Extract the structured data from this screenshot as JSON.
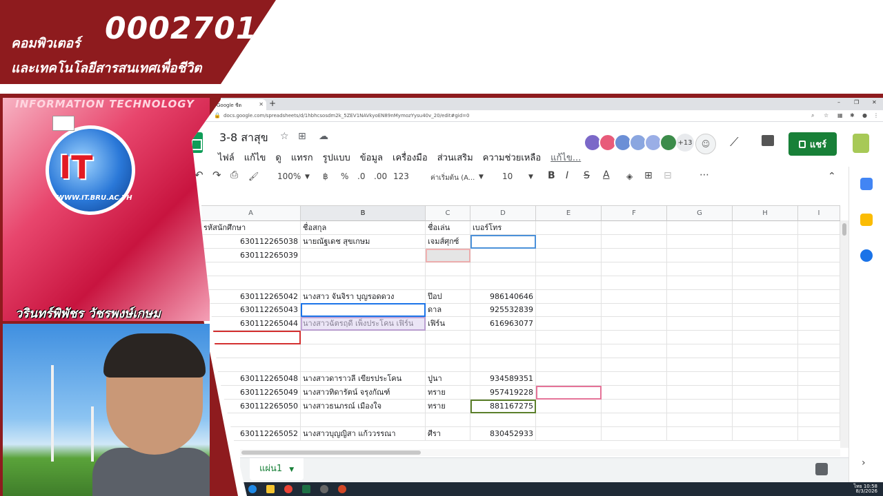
{
  "overlay": {
    "course_code": "0002701",
    "course_line1": "คอมพิวเตอร์",
    "course_line2": "และเทคโนโลยีสารสนเทศเพื่อชีวิต",
    "it_header": "INFORMATION TECHNOLOGY",
    "it_logo": "IT",
    "it_site": "WWW.IT.BRU.AC.TH",
    "presenter": "วรินทร์พิพัชร วัชรพงษ์เกษม"
  },
  "browser": {
    "tab_title": "Google ชีต",
    "new_tab": "+",
    "url": "docs.google.com/spreadsheets/d/1hbhcsosdm2k_5ZEV1NAVkyoEN89nMymozYysu40v_20/edit#gid=0",
    "window_controls": [
      "–",
      "❐",
      "✕"
    ]
  },
  "doc": {
    "title": "3-8 สาสุข",
    "menu": [
      "ไฟล์",
      "แก้ไข",
      "ดู",
      "แทรก",
      "รูปแบบ",
      "ข้อมูล",
      "เครื่องมือ",
      "ส่วนเสริม",
      "ความช่วยเหลือ",
      "แก้ไข..."
    ],
    "collaborators_more": "+13",
    "share_label": "แชร์"
  },
  "toolbar": {
    "undo": "↶",
    "redo": "↷",
    "print": "⎙",
    "zoom": "100%",
    "currency": "฿",
    "percent": "%",
    "dec_less": ".0",
    "dec_more": ".00",
    "format_more": "123",
    "font": "ค่าเริ่มต้น (A...",
    "font_size": "10",
    "bold": "B",
    "italic": "I",
    "strike": "S",
    "text_color": "A",
    "more": "⋯",
    "collapse": "⌃"
  },
  "grid": {
    "columns": [
      "A",
      "B",
      "C",
      "D",
      "E",
      "F",
      "G",
      "H",
      "I"
    ],
    "selected_column": "B",
    "rows": [
      [
        "รหัสนักศึกษา",
        "ชื่อสกุล",
        "ชื่อเล่น",
        "เบอร์โทร"
      ],
      [
        "630112265038",
        "นายณัฐเดช สุขเกษม",
        "เจมส์ศุกซ์",
        ""
      ],
      [
        "630112265039",
        "",
        "",
        ""
      ],
      [
        "",
        "",
        "",
        ""
      ],
      [
        "",
        "",
        "",
        ""
      ],
      [
        "630112265042",
        "นางสาว จันจิรา บุญรอดดวง",
        "ป๊อป",
        "986140646"
      ],
      [
        "630112265043",
        "",
        "ดาล",
        "925532839"
      ],
      [
        "630112265044",
        "นางสาวฉัตรฤดี เพ็งประโคน    เฟิร์น",
        "เฟิร์น",
        "616963077"
      ],
      [
        "",
        "",
        "",
        ""
      ],
      [
        "",
        "",
        "",
        ""
      ],
      [
        "",
        "",
        "",
        ""
      ],
      [
        "630112265048",
        "นางสาวดาราวลี เขียรประโคน",
        "ปูนา",
        "934589351"
      ],
      [
        "630112265049",
        "นางสาวทิดารัตน์ จรุงกัณฑ์",
        "ทราย",
        "957419228"
      ],
      [
        "630112265050",
        "นางสาวธนภรณ์  เมืองใจ",
        "ทราย",
        "881167275"
      ],
      [
        "",
        "",
        "",
        ""
      ],
      [
        "630112265052",
        "นางสาวบุญญิสา แก้ววรรณา",
        "ศีรา",
        "830452933"
      ]
    ]
  },
  "sheet_tabs": [
    "แผ่น1"
  ],
  "tray": {
    "time": "10:58",
    "date": "8/3/2026",
    "lang": "ไทย"
  },
  "colors": {
    "brand_maroon": "#8e1b1e",
    "sheets_green": "#188038",
    "selection_blue": "#1a73e8"
  }
}
